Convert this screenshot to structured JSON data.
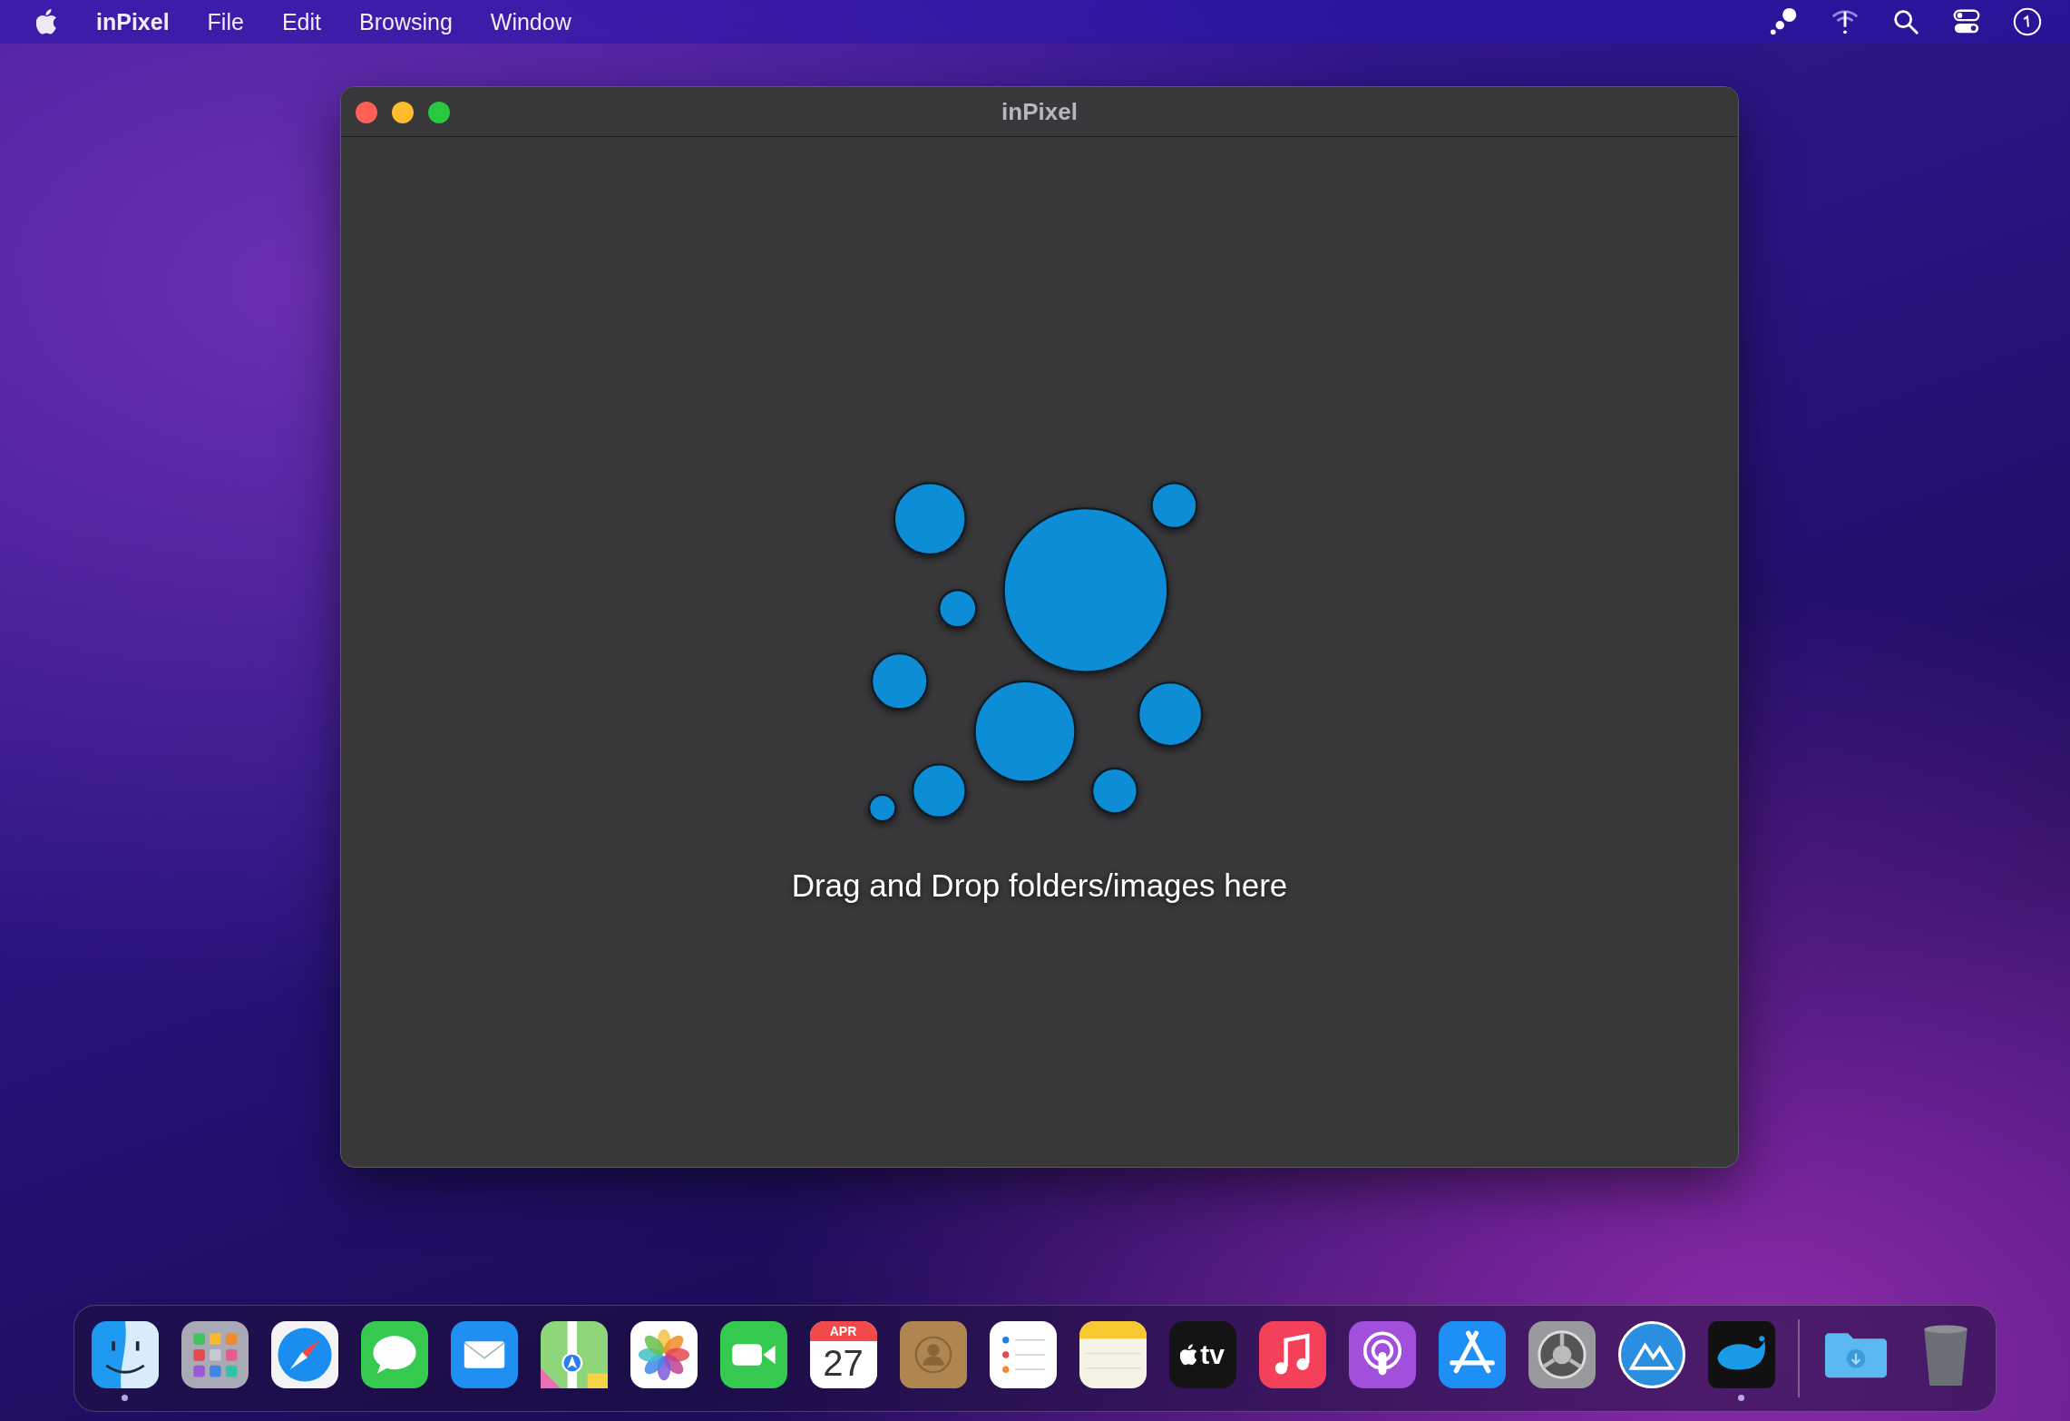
{
  "menu_bar": {
    "items": [
      {
        "label": "inPixel",
        "kind": "app"
      },
      {
        "label": "File",
        "kind": "menu"
      },
      {
        "label": "Edit",
        "kind": "menu"
      },
      {
        "label": "Browsing",
        "kind": "menu"
      },
      {
        "label": "Window",
        "kind": "menu"
      }
    ]
  },
  "window": {
    "title": "inPixel",
    "message": "Drag and Drop folders/images here"
  },
  "dock": {
    "items": [
      {
        "kind": "finder",
        "running": true
      },
      {
        "kind": "launchpad",
        "running": false
      },
      {
        "kind": "safari",
        "running": false
      },
      {
        "kind": "messages",
        "running": false
      },
      {
        "kind": "mail",
        "running": false
      },
      {
        "kind": "maps",
        "running": false
      },
      {
        "kind": "photos",
        "running": false
      },
      {
        "kind": "facetime",
        "running": false
      },
      {
        "kind": "calendar",
        "running": false,
        "month": "APR",
        "day": "27"
      },
      {
        "kind": "contacts",
        "running": false
      },
      {
        "kind": "reminders",
        "running": false
      },
      {
        "kind": "notes",
        "running": false
      },
      {
        "kind": "tv",
        "running": false,
        "label": "tv"
      },
      {
        "kind": "music",
        "running": false
      },
      {
        "kind": "podcasts",
        "running": false
      },
      {
        "kind": "appstore",
        "running": false
      },
      {
        "kind": "settings",
        "running": false
      },
      {
        "kind": "mountain",
        "running": false
      },
      {
        "kind": "whale",
        "running": true
      },
      {
        "kind": "separator"
      },
      {
        "kind": "downloads",
        "running": false
      },
      {
        "kind": "trash",
        "running": false
      }
    ]
  }
}
